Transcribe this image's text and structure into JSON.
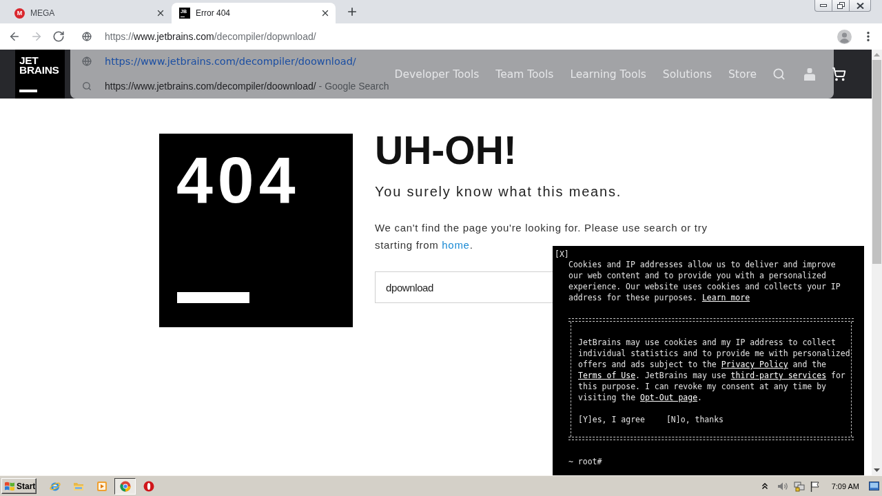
{
  "browser": {
    "tabs": [
      {
        "title": "MEGA",
        "favicon": {
          "kind": "round",
          "letter": "M"
        },
        "selected": false
      },
      {
        "title": "Error 404",
        "favicon": {
          "kind": "square",
          "letter": "JB"
        },
        "selected": true
      }
    ],
    "nav_buttons": [
      {
        "kind": "back",
        "disabled": false
      },
      {
        "kind": "forward",
        "disabled": true
      },
      {
        "kind": "reload",
        "disabled": false
      }
    ],
    "address_bar": {
      "scheme": "https://",
      "host": "www.jetbrains.com",
      "path": "/decompiler/dopwnload/"
    },
    "suggestions": [
      {
        "kind": "url",
        "text": "https://www.jetbrains.com/decompiler/doownload/"
      },
      {
        "kind": "search",
        "text": "https://www.jetbrains.com/decompiler/doownload/",
        "suffix": "- Google Search"
      }
    ]
  },
  "site_header": {
    "logo_lines": [
      "JET",
      "BRAINS"
    ],
    "nav": [
      "Developer Tools",
      "Team Tools",
      "Learning Tools",
      "Solutions",
      "Store"
    ]
  },
  "error_page": {
    "code": "404",
    "heading": "UH-OH!",
    "subheading": "You surely know what this means.",
    "message": [
      {
        "kind": "text",
        "text": "We can't find the page you're looking for. Please use search or try starting from "
      },
      {
        "kind": "link",
        "text": "home"
      },
      {
        "kind": "text",
        "text": "."
      }
    ],
    "search": {
      "value": "dpownload"
    }
  },
  "cookie_banner": {
    "close": "[X]",
    "intro": [
      {
        "kind": "text",
        "text": "Cookies and IP addresses allow us to deliver and improve our web content and to provide you with a personalized experience. Our website uses cookies and collects your IP address for these purposes. "
      },
      {
        "kind": "link",
        "text": "Learn more"
      }
    ],
    "consent": [
      {
        "kind": "text",
        "text": "JetBrains may use cookies and my IP address to collect individual statistics and to provide me with personalized offers and ads subject to the "
      },
      {
        "kind": "link",
        "text": "Privacy Policy"
      },
      {
        "kind": "text",
        "text": " and the "
      },
      {
        "kind": "link",
        "text": "Terms of Use"
      },
      {
        "kind": "text",
        "text": ". JetBrains may use "
      },
      {
        "kind": "link",
        "text": "third-party services"
      },
      {
        "kind": "text",
        "text": " for this purpose. I can revoke my consent at any time by visiting the "
      },
      {
        "kind": "link",
        "text": "Opt-Out page"
      },
      {
        "kind": "text",
        "text": "."
      }
    ],
    "actions": [
      "[Y]es, I agree",
      "[N]o, thanks"
    ],
    "prompt": "~ root#"
  },
  "taskbar": {
    "start": "Start",
    "apps": [
      {
        "kind": "ie",
        "selected": false
      },
      {
        "kind": "folder",
        "selected": false
      },
      {
        "kind": "player",
        "selected": false
      },
      {
        "kind": "chrome",
        "selected": true
      },
      {
        "kind": "ring",
        "selected": false
      }
    ],
    "clock": "7:09 AM"
  }
}
